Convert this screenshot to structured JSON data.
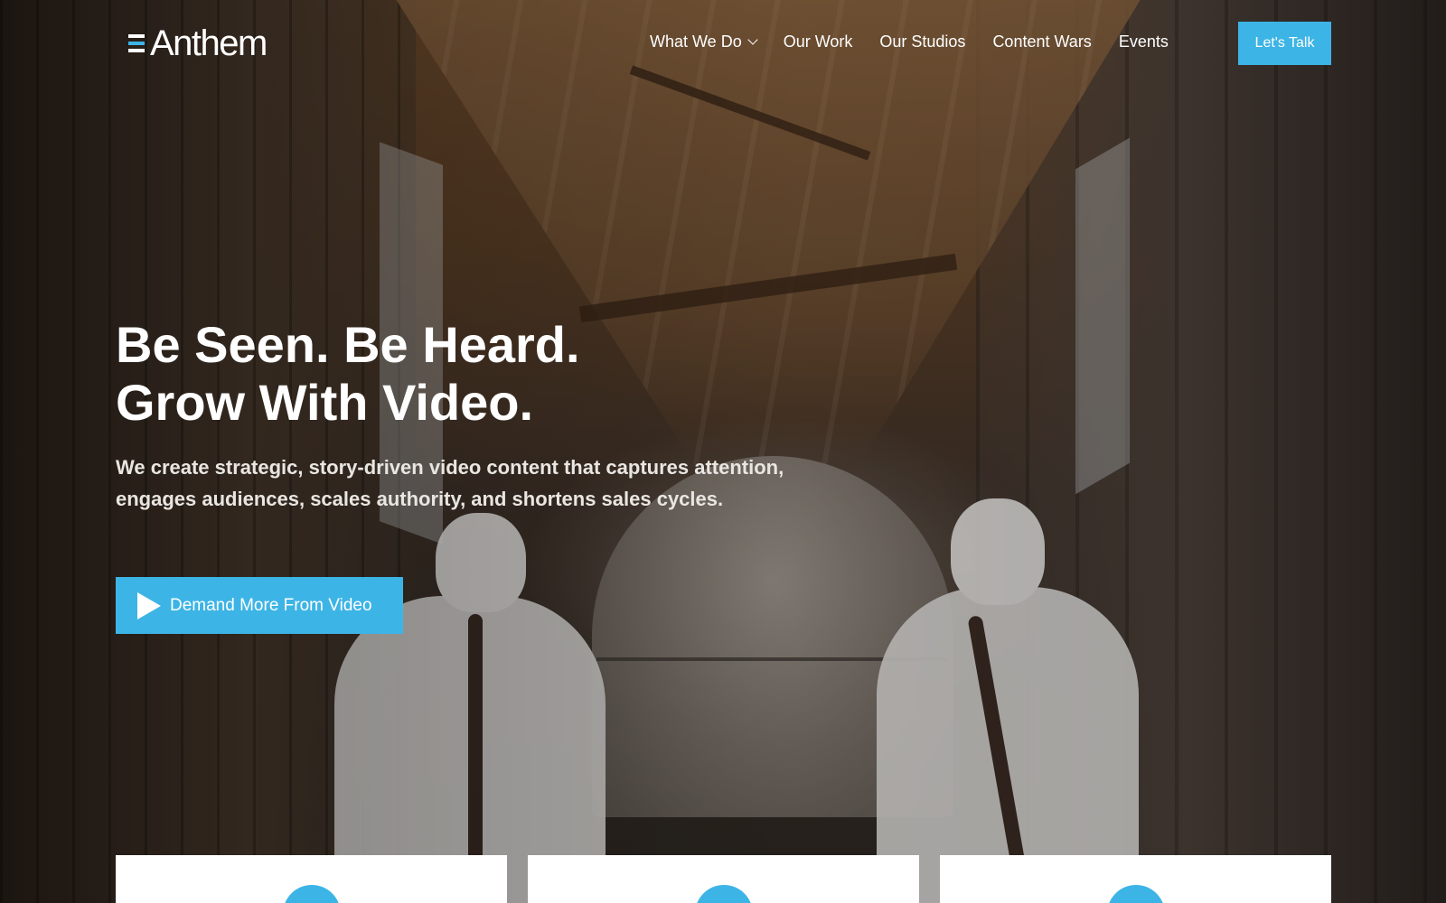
{
  "brand": {
    "name": "Anthem",
    "accent": "#3db4e6"
  },
  "nav": {
    "items": [
      {
        "label": "What We Do",
        "has_dropdown": true
      },
      {
        "label": "Our Work"
      },
      {
        "label": "Our Studios"
      },
      {
        "label": "Content Wars"
      },
      {
        "label": "Events"
      }
    ],
    "cta_label": "Let's Talk"
  },
  "hero": {
    "headline_line1": "Be Seen. Be Heard.",
    "headline_line2": "Grow With Video.",
    "subtext": "We create strategic, story-driven video content that captures attention, engages audiences, scales authority, and shortens sales cycles.",
    "cta_label": "Demand More From Video",
    "cta_icon": "play-icon"
  },
  "cards": [
    {
      "icon": "feature-icon"
    },
    {
      "icon": "feature-icon"
    },
    {
      "icon": "feature-icon"
    }
  ]
}
